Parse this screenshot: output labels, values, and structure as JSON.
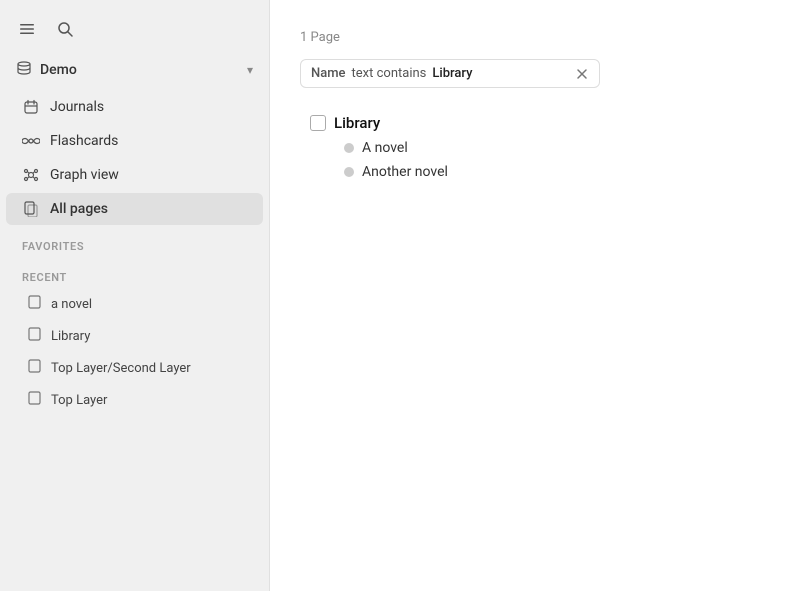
{
  "sidebar": {
    "menu_icon": "☰",
    "search_icon": "🔍",
    "workspace": {
      "icon": "▤",
      "label": "Demo",
      "chevron": "▾"
    },
    "nav_items": [
      {
        "id": "journals",
        "label": "Journals",
        "icon": "calendar"
      },
      {
        "id": "flashcards",
        "label": "Flashcards",
        "icon": "infinity"
      },
      {
        "id": "graph-view",
        "label": "Graph view",
        "icon": "graph"
      },
      {
        "id": "all-pages",
        "label": "All pages",
        "icon": "pages",
        "active": true
      }
    ],
    "favorites_label": "FAVORITES",
    "recent_label": "RECENT",
    "recent_items": [
      {
        "id": "a-novel",
        "label": "a novel"
      },
      {
        "id": "library",
        "label": "Library"
      },
      {
        "id": "top-layer-second-layer",
        "label": "Top Layer/Second Layer"
      },
      {
        "id": "top-layer",
        "label": "Top Layer"
      }
    ]
  },
  "main": {
    "page_count": "1 Page",
    "filter": {
      "field": "Name",
      "operator": "text contains",
      "value": "Library",
      "clear_label": "×"
    },
    "results": [
      {
        "title": "Library",
        "children": [
          {
            "text": "A novel"
          },
          {
            "text": "Another novel"
          }
        ]
      }
    ]
  }
}
